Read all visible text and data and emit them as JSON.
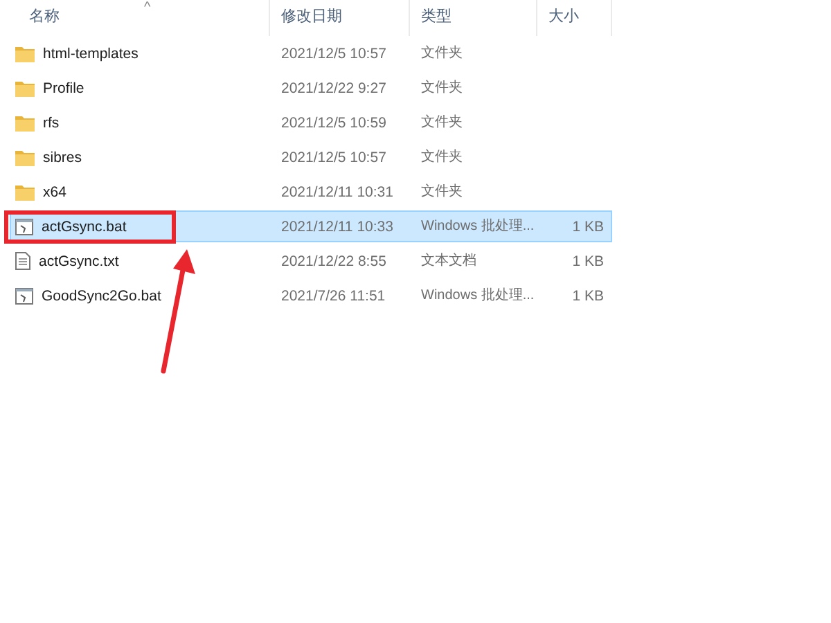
{
  "columns": [
    "名称",
    "修改日期",
    "类型",
    "大小"
  ],
  "sort_indicator": "^",
  "rows": [
    {
      "kind": "folder",
      "name": "html-templates",
      "modified": "2021/12/5 10:57",
      "type": "文件夹",
      "size": "",
      "selected": false,
      "highlighted": false
    },
    {
      "kind": "folder",
      "name": "Profile",
      "modified": "2021/12/22 9:27",
      "type": "文件夹",
      "size": "",
      "selected": false,
      "highlighted": false
    },
    {
      "kind": "folder",
      "name": "rfs",
      "modified": "2021/12/5 10:59",
      "type": "文件夹",
      "size": "",
      "selected": false,
      "highlighted": false
    },
    {
      "kind": "folder",
      "name": "sibres",
      "modified": "2021/12/5 10:57",
      "type": "文件夹",
      "size": "",
      "selected": false,
      "highlighted": false
    },
    {
      "kind": "folder",
      "name": "x64",
      "modified": "2021/12/11 10:31",
      "type": "文件夹",
      "size": "",
      "selected": false,
      "highlighted": false
    },
    {
      "kind": "bat",
      "name": "actGsync.bat",
      "modified": "2021/12/11 10:33",
      "type": "Windows 批处理...",
      "size": "1 KB",
      "selected": true,
      "highlighted": true
    },
    {
      "kind": "txt",
      "name": "actGsync.txt",
      "modified": "2021/12/22 8:55",
      "type": "文本文档",
      "size": "1 KB",
      "selected": false,
      "highlighted": false
    },
    {
      "kind": "bat",
      "name": "GoodSync2Go.bat",
      "modified": "2021/7/26 11:51",
      "type": "Windows 批处理...",
      "size": "1 KB",
      "selected": false,
      "highlighted": false
    }
  ]
}
